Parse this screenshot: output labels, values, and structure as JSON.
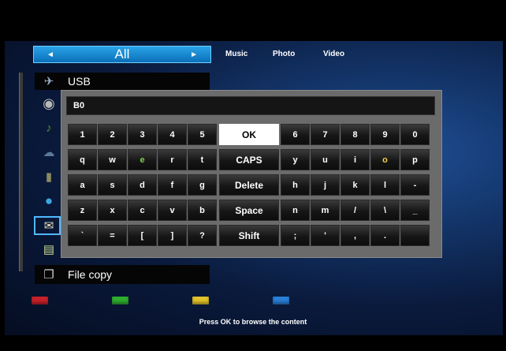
{
  "category_bar": {
    "current": "All",
    "prev_arrow": "◄",
    "next_arrow": "►"
  },
  "media_tabs": [
    "Music",
    "Photo",
    "Video"
  ],
  "sidebar": {
    "items": [
      {
        "icon": "usb-icon",
        "label": "USB"
      },
      {
        "icon": "disc-icon",
        "label": ""
      },
      {
        "icon": "music-note-icon",
        "label": ""
      },
      {
        "icon": "network-icon",
        "label": ""
      },
      {
        "icon": "upnp-icon",
        "label": ""
      },
      {
        "icon": "globe-icon",
        "label": ""
      },
      {
        "icon": "photo-folder-icon",
        "label": ""
      },
      {
        "icon": "playlist-icon",
        "label": ""
      },
      {
        "icon": "file-copy-icon",
        "label": "File copy"
      }
    ]
  },
  "keyboard": {
    "input_value": "B0",
    "rows": [
      [
        "1",
        "2",
        "3",
        "4",
        "5",
        "OK",
        "6",
        "7",
        "8",
        "9",
        "0"
      ],
      [
        "q",
        "w",
        "e",
        "r",
        "t",
        "CAPS",
        "y",
        "u",
        "i",
        "o",
        "p"
      ],
      [
        "a",
        "s",
        "d",
        "f",
        "g",
        "Delete",
        "h",
        "j",
        "k",
        "l",
        "-"
      ],
      [
        "z",
        "x",
        "c",
        "v",
        "b",
        "Space",
        "n",
        "m",
        "/",
        "\\",
        "_"
      ],
      [
        "`",
        "=",
        "[",
        "]",
        "?",
        "Shift",
        ";",
        "'",
        ",",
        ".",
        ""
      ]
    ],
    "focused_key": "OK",
    "key_colors": {
      "e": "#7dd34a",
      "o": "#f0d24a",
      "1": "#ffffff"
    }
  },
  "color_buttons": [
    {
      "name": "red",
      "color": "#c8202a"
    },
    {
      "name": "green",
      "color": "#2fae2f"
    },
    {
      "name": "yellow",
      "color": "#e3c32a"
    },
    {
      "name": "blue",
      "color": "#2a7fd8"
    }
  ],
  "hint": "Press OK to browse the content"
}
